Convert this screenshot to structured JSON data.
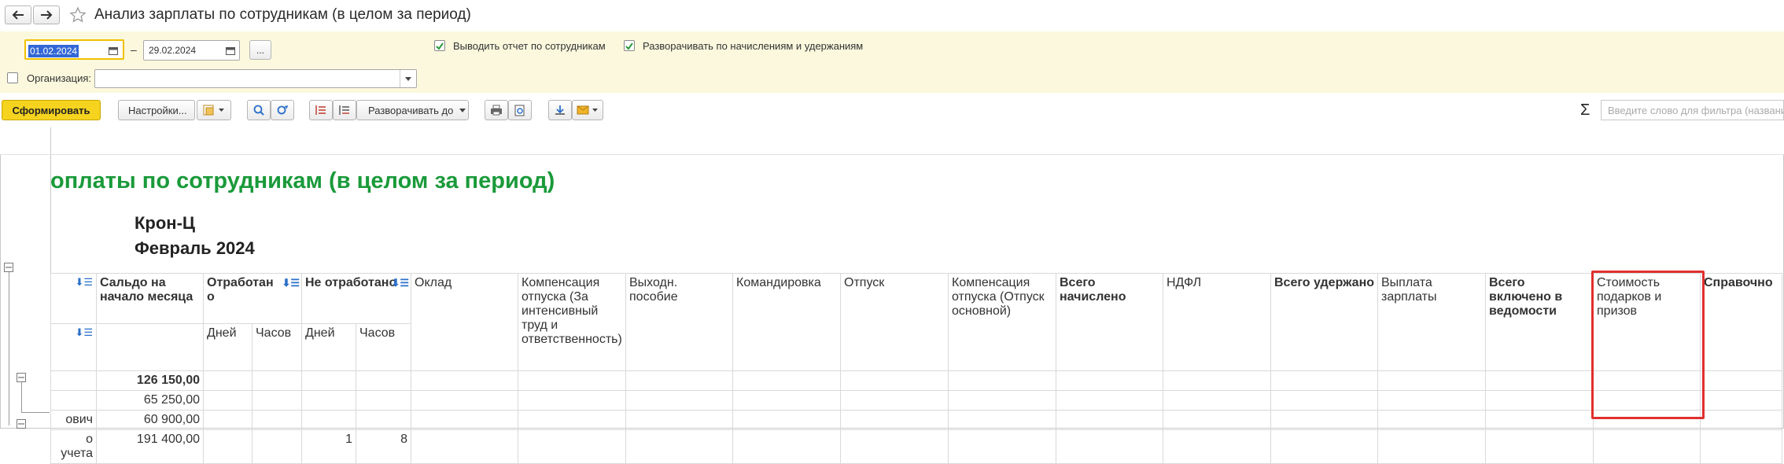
{
  "window": {
    "title": "Анализ зарплаты по сотрудникам (в целом за период)"
  },
  "params": {
    "date_from": "01.02.2024",
    "date_sep": "–",
    "date_to": "29.02.2024",
    "more_btn": "...",
    "opt_by_employees": "Выводить отчет по сотрудникам",
    "opt_expand": "Разворачивать по начислениям и удержаниям",
    "org_label": "Организация:",
    "org_value": ""
  },
  "toolbar": {
    "generate": "Сформировать",
    "settings": "Настройки...",
    "expand_to": "Разворачивать до",
    "sigma": "Σ",
    "filter_placeholder": "Введите слово для фильтра (названи"
  },
  "report": {
    "title": "оплаты по сотрудникам (в целом за период)",
    "org": "Крон-Ц",
    "period": "Февраль 2024",
    "headers": {
      "saldo": "Сальдо на начало месяца",
      "worked": "Отработан о",
      "not_worked": "Не отработано",
      "days": "Дней",
      "hours": "Часов",
      "oklad": "Оклад",
      "comp_intensive": "Компенсация отпуска (За интенсивный труд и ответственность)",
      "severance": "Выходн. пособие",
      "business_trip": "Командировка",
      "vacation": "Отпуск",
      "comp_main": "Компенсация отпуска (Отпуск основной)",
      "total_accrued": "Всего начислено",
      "ndfl": "НДФЛ",
      "total_withheld": "Всего удержано",
      "salary_payment": "Выплата зарплаты",
      "total_in_statement": "Всего включено в ведомости",
      "gifts_cost": "Стоимость подарков и призов",
      "reference": "Справочно"
    },
    "rows": [
      {
        "label": "",
        "saldo": "126 150,00",
        "nw_days": "",
        "nw_hours": ""
      },
      {
        "label": "",
        "saldo": "65 250,00",
        "nw_days": "",
        "nw_hours": ""
      },
      {
        "label": "ович",
        "saldo": "60 900,00",
        "nw_days": "",
        "nw_hours": ""
      },
      {
        "label": "о учета",
        "saldo": "191 400,00",
        "nw_days": "1",
        "nw_hours": "8"
      }
    ]
  },
  "colors": {
    "accent_yellow": "#f5d31e",
    "panel_bg": "#fbf8dd",
    "title_green": "#1a9a3a",
    "highlight_red": "#e0302d"
  }
}
